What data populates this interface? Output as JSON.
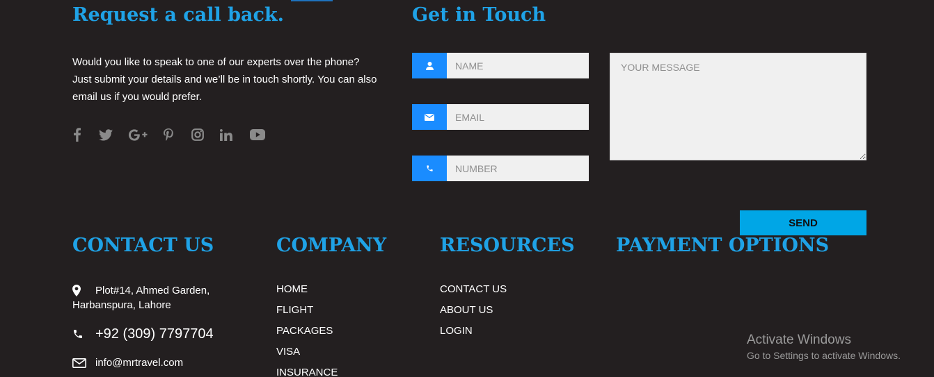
{
  "callback": {
    "title": "Request a call back.",
    "text": "Would you like to speak to one of our experts over the phone? Just submit your details and we’ll be in touch shortly. You can also email us if you would prefer."
  },
  "social": [
    "facebook-icon",
    "twitter-icon",
    "google-plus-icon",
    "pinterest-icon",
    "instagram-icon",
    "linkedin-icon",
    "youtube-icon"
  ],
  "touch": {
    "title": "Get in Touch",
    "name_placeholder": "NAME",
    "email_placeholder": "EMAIL",
    "number_placeholder": "NUMBER",
    "message_placeholder": "YOUR MESSAGE",
    "send_label": "SEND"
  },
  "footer": {
    "contact": {
      "title": "CONTACT US",
      "address_line1": "Plot#14, Ahmed Garden,",
      "address_line2": "Harbanspura, Lahore",
      "phone": "+92 (309) 7797704",
      "email": "info@mrtravel.com"
    },
    "company": {
      "title": "COMPANY",
      "links": [
        "HOME",
        "FLIGHT",
        "PACKAGES",
        "VISA",
        "INSURANCE"
      ]
    },
    "resources": {
      "title": "RESOURCES",
      "links": [
        "CONTACT US",
        "ABOUT US",
        "LOGIN"
      ]
    },
    "payment": {
      "title": "PAYMENT OPTIONS"
    }
  },
  "watermark": {
    "line1": "Activate Windows",
    "line2": "Go to Settings to activate Windows."
  },
  "colors": {
    "background": "#231f20",
    "heading": "#1fa2e6",
    "field_icon_bg": "#1a8cff",
    "send_bg": "#00a6e6",
    "social_icon": "#8a8a8a"
  }
}
